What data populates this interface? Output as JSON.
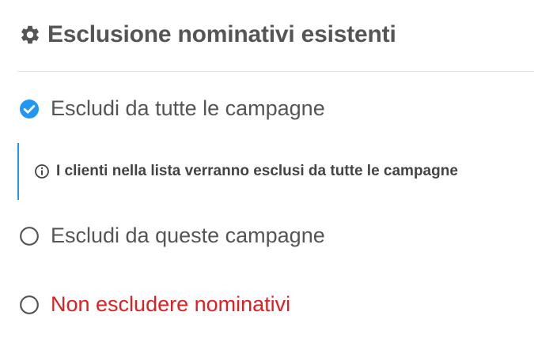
{
  "section": {
    "title": "Esclusione nominativi esistenti",
    "icon": "gear-icon"
  },
  "options": [
    {
      "label": "Escludi da tutte le campagne",
      "selected": true,
      "icon": "check-circle-icon"
    },
    {
      "label": "Escludi da queste campagne",
      "selected": false,
      "icon": "radio-empty-icon"
    },
    {
      "label": "Non escludere nominativi",
      "selected": false,
      "icon": "radio-empty-icon"
    }
  ],
  "info": {
    "icon": "info-icon",
    "text": "I clienti nella lista verranno esclusi da tutte le campagne"
  },
  "colors": {
    "accent": "#2196f3",
    "text": "#555555",
    "danger": "#e02020",
    "divider": "#e2e2e2"
  }
}
